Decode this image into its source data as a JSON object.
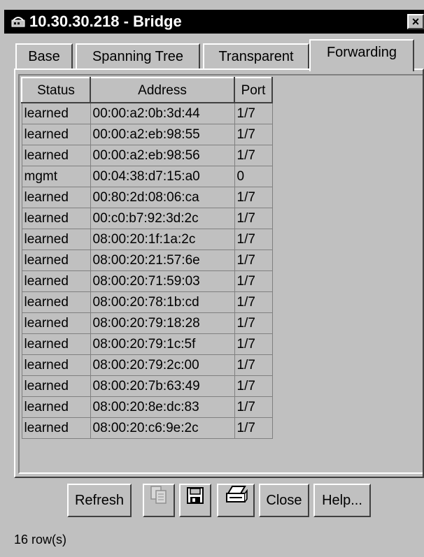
{
  "window": {
    "title": "10.30.30.218 - Bridge",
    "close_label": "×"
  },
  "tabs": [
    {
      "label": "Base",
      "selected": false
    },
    {
      "label": "Spanning Tree",
      "selected": false
    },
    {
      "label": "Transparent",
      "selected": false
    },
    {
      "label": "Forwarding",
      "selected": true
    }
  ],
  "table": {
    "headers": [
      "Status",
      "Address",
      "Port"
    ],
    "rows": [
      [
        "learned",
        "00:00:a2:0b:3d:44",
        "1/7"
      ],
      [
        "learned",
        "00:00:a2:eb:98:55",
        "1/7"
      ],
      [
        "learned",
        "00:00:a2:eb:98:56",
        "1/7"
      ],
      [
        "mgmt",
        "00:04:38:d7:15:a0",
        "0"
      ],
      [
        "learned",
        "00:80:2d:08:06:ca",
        "1/7"
      ],
      [
        "learned",
        "00:c0:b7:92:3d:2c",
        "1/7"
      ],
      [
        "learned",
        "08:00:20:1f:1a:2c",
        "1/7"
      ],
      [
        "learned",
        "08:00:20:21:57:6e",
        "1/7"
      ],
      [
        "learned",
        "08:00:20:71:59:03",
        "1/7"
      ],
      [
        "learned",
        "08:00:20:78:1b:cd",
        "1/7"
      ],
      [
        "learned",
        "08:00:20:79:18:28",
        "1/7"
      ],
      [
        "learned",
        "08:00:20:79:1c:5f",
        "1/7"
      ],
      [
        "learned",
        "08:00:20:79:2c:00",
        "1/7"
      ],
      [
        "learned",
        "08:00:20:7b:63:49",
        "1/7"
      ],
      [
        "learned",
        "08:00:20:8e:dc:83",
        "1/7"
      ],
      [
        "learned",
        "08:00:20:c6:9e:2c",
        "1/7"
      ]
    ]
  },
  "buttons": {
    "refresh": "Refresh",
    "copy_icon": "copy-icon",
    "save_icon": "floppy-disk-icon",
    "print_icon": "printer-icon",
    "close": "Close",
    "help": "Help..."
  },
  "status": {
    "row_count": "16 row(s)"
  }
}
